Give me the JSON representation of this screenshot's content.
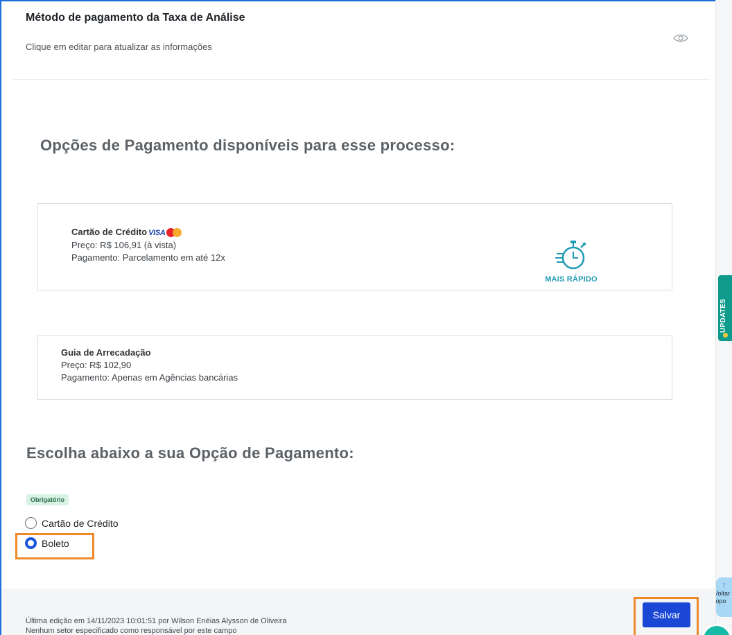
{
  "header": {
    "title": "Método de pagamento da Taxa de Análise",
    "subtitle": "Clique em editar para atualizar as informações",
    "eye_icon": "eye-icon"
  },
  "options": {
    "title": "Opções de Pagamento disponíveis para esse processo:",
    "credit_card": {
      "title": "Cartão de Crédito",
      "brand_visa": "VISA",
      "brand_mastercard": "MasterCard",
      "price": "Preço: R$ 106,91 (à vista)",
      "payment": "Pagamento: Parcelamento em até 12x",
      "badge_icon": "stopwatch-icon",
      "badge_label": "MAIS RÁPIDO",
      "badge_color": "#1f9bb5"
    },
    "guia": {
      "title": "Guia de Arrecadação",
      "price": "Preço: R$ 102,90",
      "payment": "Pagamento: Apenas em Agências bancárias"
    }
  },
  "choice": {
    "title": "Escolha abaixo a sua Opção de Pagamento:",
    "required_label": "Obrigatório",
    "options": [
      {
        "label": "Cartão de Crédito",
        "selected": false
      },
      {
        "label": "Boleto",
        "selected": true
      }
    ]
  },
  "footer": {
    "last_edit": "Última edição em 14/11/2023 10:01:51 por Wilson Enéias Alysson de Oliveira",
    "no_sector": "Nenhum setor especificado como responsável por este campo",
    "save_label": "Salvar"
  },
  "side": {
    "updates_label": "UPDATES",
    "back_to_top_arrow": "↑",
    "back_to_top_label": "Voltar ao topo"
  },
  "colors": {
    "accent": "#1a47d4",
    "highlight": "#ef8a2b",
    "updates": "#0e9b8c",
    "required_bg": "#d8f3e3"
  }
}
